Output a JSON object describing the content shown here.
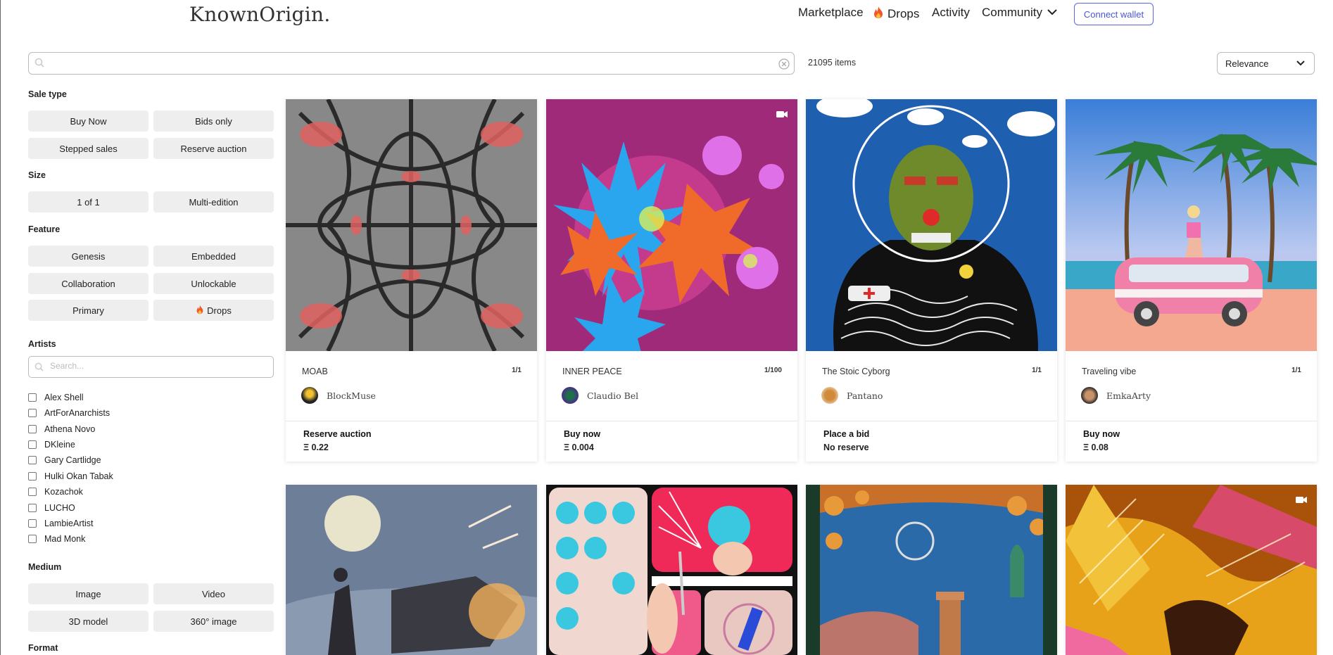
{
  "header": {
    "logo": "KnownOrigin.",
    "nav": {
      "marketplace": "Marketplace",
      "drops": "Drops",
      "activity": "Activity",
      "community": "Community"
    },
    "connect": "Connect wallet"
  },
  "search": {
    "placeholder": ""
  },
  "results": {
    "count": "21095 items",
    "sort": "Relevance"
  },
  "sidebar": {
    "sale_type": {
      "heading": "Sale type",
      "options": [
        "Buy Now",
        "Bids only",
        "Stepped sales",
        "Reserve auction"
      ]
    },
    "size": {
      "heading": "Size",
      "options": [
        "1 of 1",
        "Multi-edition"
      ]
    },
    "feature": {
      "heading": "Feature",
      "options": [
        "Genesis",
        "Embedded",
        "Collaboration",
        "Unlockable",
        "Primary",
        "Drops"
      ]
    },
    "artists": {
      "heading": "Artists",
      "placeholder": "Search...",
      "list": [
        "Alex Shell",
        "ArtForAnarchists",
        "Athena Novo",
        "DKleine",
        "Gary Cartlidge",
        "Hulki Okan Tabak",
        "Kozachok",
        "LUCHO",
        "LambieArtist",
        "Mad Monk"
      ]
    },
    "medium": {
      "heading": "Medium",
      "options": [
        "Image",
        "Video",
        "3D model",
        "360° image"
      ]
    },
    "format": {
      "heading": "Format"
    }
  },
  "cards": [
    {
      "title": "MOAB",
      "edition": "1/1",
      "artist": "BlockMuse",
      "sale": "Reserve auction",
      "price": "Ξ 0.22"
    },
    {
      "title": "INNER PEACE",
      "edition": "1/100",
      "artist": "Claudio Bel",
      "sale": "Buy now",
      "price": "Ξ 0.004"
    },
    {
      "title": "The Stoic Cyborg",
      "edition": "1/1",
      "artist": "Pantano",
      "sale": "Place a bid",
      "price": "No reserve"
    },
    {
      "title": "Traveling vibe",
      "edition": "1/1",
      "artist": "EmkaArty",
      "sale": "Buy now",
      "price": "Ξ 0.08"
    }
  ],
  "colors": {
    "accent": "#5a66e8",
    "chip": "#eeeeee",
    "fire": "#f0582a"
  }
}
